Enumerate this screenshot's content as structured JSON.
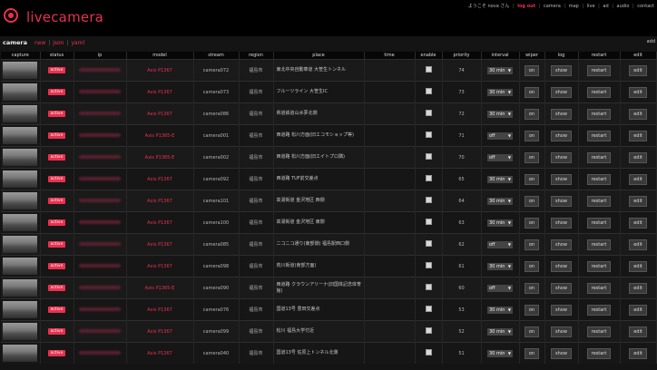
{
  "app": {
    "title": "livecamera"
  },
  "topnav": {
    "greeting": "ようこそ nova さん",
    "logout": "log out",
    "items": [
      "camera",
      "map",
      "live",
      "ad",
      "audio",
      "contact"
    ]
  },
  "subnav": {
    "current": "camera",
    "links": [
      "new",
      "json",
      "yaml"
    ]
  },
  "add_label": "add",
  "colors": {
    "accent": "#e8314f",
    "background": "#141414"
  },
  "columns": [
    "capture",
    "status",
    "ip",
    "model",
    "stream",
    "region",
    "place",
    "time",
    "enable",
    "priority",
    "interval",
    "wiper",
    "log",
    "restart",
    "edit"
  ],
  "rows": [
    {
      "status": "active",
      "model": "Axis P1367",
      "stream": "camera072",
      "region": "福島市",
      "place": "東北中央自動車道 大笹生トンネル",
      "enable": true,
      "priority": "74",
      "interval": "30 min",
      "wiper": "on",
      "log": "show",
      "restart": "restart",
      "edit": "edit"
    },
    {
      "status": "active",
      "model": "Axis P1367",
      "stream": "camera073",
      "region": "福島市",
      "place": "フルーツライン 大笹生IC",
      "enable": true,
      "priority": "73",
      "interval": "30 min",
      "wiper": "on",
      "log": "show",
      "restart": "restart",
      "edit": "edit"
    },
    {
      "status": "active",
      "model": "Axis P1367",
      "stream": "camera086",
      "region": "福島市",
      "place": "県道鉄道山水夢北側",
      "enable": true,
      "priority": "72",
      "interval": "30 min",
      "wiper": "on",
      "log": "show",
      "restart": "restart",
      "edit": "edit"
    },
    {
      "status": "active",
      "model": "Axis P1365-E",
      "stream": "camera001",
      "region": "福島市",
      "place": "西道路 松川方面(旧エコモショップ等)",
      "enable": true,
      "priority": "71",
      "interval": "off",
      "wiper": "on",
      "log": "show",
      "restart": "restart",
      "edit": "edit"
    },
    {
      "status": "active",
      "model": "Axis P1365-E",
      "stream": "camera002",
      "region": "福島市",
      "place": "西道路 松川方面(旧エイトプロ隣)",
      "enable": true,
      "priority": "70",
      "interval": "off",
      "wiper": "on",
      "log": "show",
      "restart": "restart",
      "edit": "edit"
    },
    {
      "status": "active",
      "model": "Axis P1367",
      "stream": "camera092",
      "region": "福島市",
      "place": "西道路 TUF前交差点",
      "enable": true,
      "priority": "65",
      "interval": "30 min",
      "wiper": "on",
      "log": "show",
      "restart": "restart",
      "edit": "edit"
    },
    {
      "status": "active",
      "model": "Axis P1367",
      "stream": "camera101",
      "region": "福島市",
      "place": "高湯街道 金沢地区 西側",
      "enable": true,
      "priority": "64",
      "interval": "30 min",
      "wiper": "on",
      "log": "show",
      "restart": "restart",
      "edit": "edit"
    },
    {
      "status": "active",
      "model": "Axis P1367",
      "stream": "camera100",
      "region": "福島市",
      "place": "高湯街道 金沢地区 東側",
      "enable": true,
      "priority": "63",
      "interval": "30 min",
      "wiper": "on",
      "log": "show",
      "restart": "restart",
      "edit": "edit"
    },
    {
      "status": "active",
      "model": "Axis P1367",
      "stream": "camera085",
      "region": "福島市",
      "place": "ニコニコ通り(東部側) 福島駅西口側",
      "enable": true,
      "priority": "62",
      "interval": "off",
      "wiper": "on",
      "log": "show",
      "restart": "restart",
      "edit": "edit"
    },
    {
      "status": "active",
      "model": "Axis P1367",
      "stream": "camera098",
      "region": "福島市",
      "place": "荒川街道(南部方面)",
      "enable": true,
      "priority": "61",
      "interval": "30 min",
      "wiper": "on",
      "log": "show",
      "restart": "restart",
      "edit": "edit"
    },
    {
      "status": "active",
      "model": "Axis P1365-E",
      "stream": "camera090",
      "region": "福島市",
      "place": "西道路 クラウンアリーナ(旧国体記念体育館)",
      "enable": true,
      "priority": "60",
      "interval": "off",
      "wiper": "on",
      "log": "show",
      "restart": "restart",
      "edit": "edit"
    },
    {
      "status": "active",
      "model": "Axis P1367",
      "stream": "camera076",
      "region": "福島市",
      "place": "国道13号 豊田交差点",
      "enable": true,
      "priority": "53",
      "interval": "30 min",
      "wiper": "on",
      "log": "show",
      "restart": "restart",
      "edit": "edit"
    },
    {
      "status": "active",
      "model": "Axis P1367",
      "stream": "camera099",
      "region": "福島市",
      "place": "松川 福島大学付近",
      "enable": true,
      "priority": "52",
      "interval": "30 min",
      "wiper": "on",
      "log": "show",
      "restart": "restart",
      "edit": "edit"
    },
    {
      "status": "active",
      "model": "Axis P1367",
      "stream": "camera040",
      "region": "福島市",
      "place": "国道13号 佐原上トンネル北側",
      "enable": true,
      "priority": "51",
      "interval": "30 min",
      "wiper": "on",
      "log": "show",
      "restart": "restart",
      "edit": "edit"
    }
  ]
}
